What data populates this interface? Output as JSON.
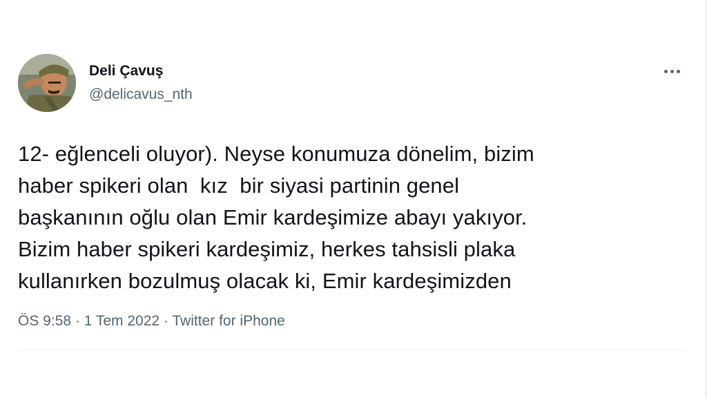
{
  "user": {
    "display_name": "Deli Çavuş",
    "handle": "@delicavus_nth"
  },
  "more_icon": "more-horizontal-icon",
  "tweet": {
    "text": "12- eğlenceli oluyor). Neyse konumuza dönelim, bizim\nhaber spikeri olan  kız  bir siyasi partinin genel\nbaşkanının oğlu olan Emir kardeşimize abayı yakıyor.\nBizim haber spikeri kardeşimiz, herkes tahsisli plaka\nkullanırken bozulmuş olacak ki, Emir kardeşimizden"
  },
  "meta": {
    "time": "ÖS 9:58",
    "sep1": " · ",
    "date": "1 Tem 2022",
    "sep2": " · ",
    "source": "Twitter for iPhone"
  },
  "colors": {
    "text": "#0f1419",
    "secondary": "#536471",
    "divider": "#eff3f4"
  }
}
